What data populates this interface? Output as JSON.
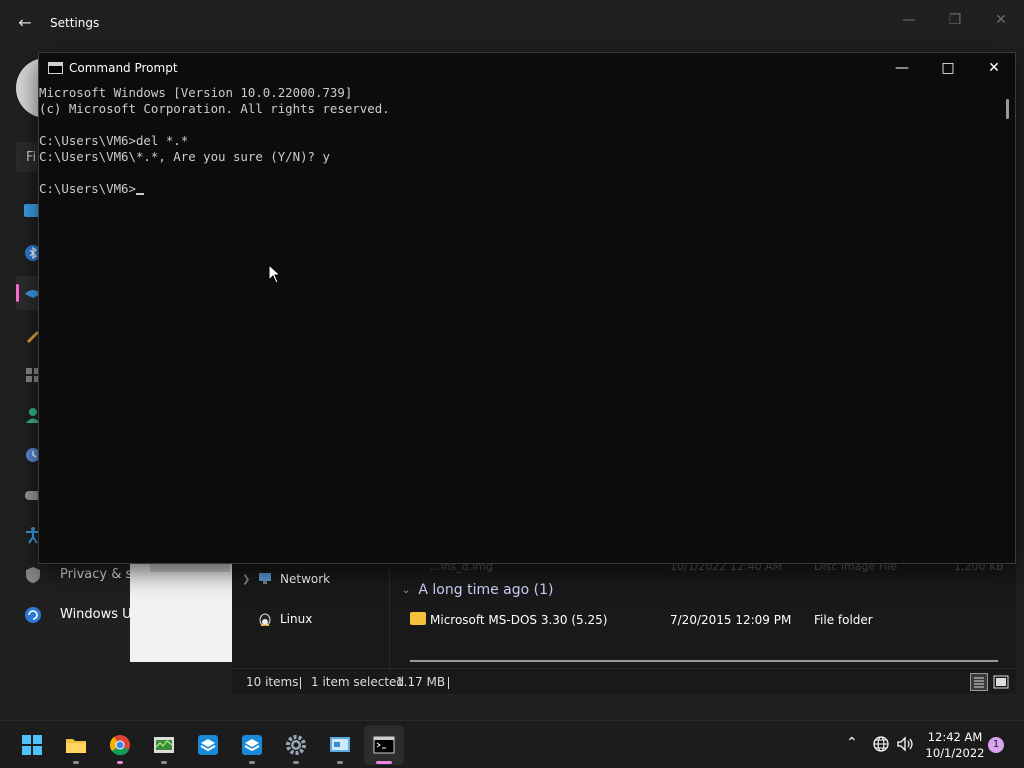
{
  "settings": {
    "title": "Settings",
    "find_partial": "Fi",
    "nav_visible": [
      {
        "label": "Privacy & s"
      },
      {
        "label": "Windows U"
      }
    ]
  },
  "explorer": {
    "nav": [
      {
        "label": "Network"
      },
      {
        "label": "Linux"
      }
    ],
    "group": "A long time ago (1)",
    "file": {
      "name": "Microsoft MS-DOS 3.30 (5.25)",
      "date": "7/20/2015 12:09 PM",
      "type": "File folder"
    },
    "faded_row": {
      "name": "...ins_d.img",
      "date": "10/1/2022 12:40 AM",
      "type": "Disc Image File",
      "size": "1,200 KB"
    },
    "status": {
      "items": "10 items",
      "selected": "1 item selected",
      "size": "1.17 MB"
    }
  },
  "cmd": {
    "title": "Command Prompt",
    "lines": [
      "Microsoft Windows [Version 10.0.22000.739]",
      "(c) Microsoft Corporation. All rights reserved.",
      "",
      "C:\\Users\\VM6>del *.*",
      "C:\\Users\\VM6\\*.*, Are you sure (Y/N)? y",
      "",
      "C:\\Users\\VM6>"
    ]
  },
  "taskbar": {
    "time": "12:42 AM",
    "date": "10/1/2022",
    "notification_count": "1",
    "apps": [
      "start-icon",
      "file-explorer-icon",
      "chrome-icon",
      "task-manager-icon",
      "sandbox-icon",
      "sandbox-2-icon",
      "settings-icon",
      "control-panel-icon",
      "command-prompt-icon"
    ]
  },
  "colors": {
    "accent": "#e78adf",
    "console_text": "#cccccc",
    "console_bg": "#0c0c0c",
    "folder": "#f3c13a"
  }
}
